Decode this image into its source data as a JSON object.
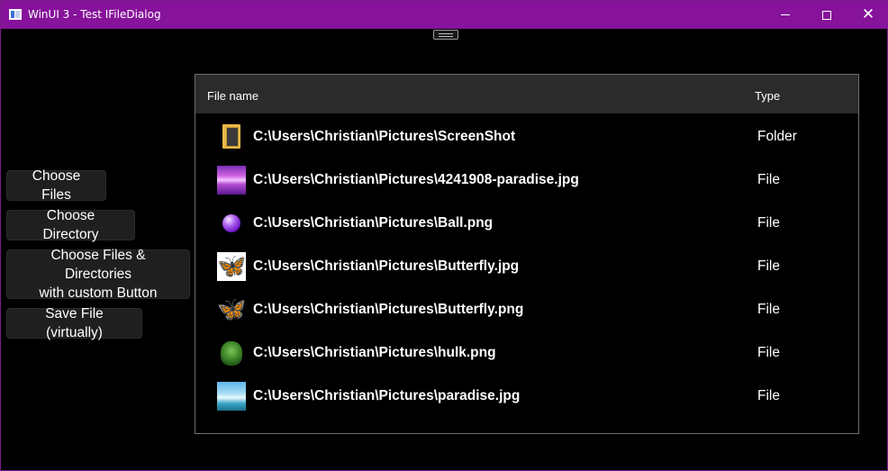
{
  "window": {
    "title": "WinUI 3 - Test IFileDialog",
    "caption": {
      "minimize": "minimize",
      "maximize": "maximize",
      "close": "✕"
    }
  },
  "buttons": {
    "choose_files": "Choose Files",
    "choose_directory": "Choose Directory",
    "choose_both_line1": "Choose Files & Directories",
    "choose_both_line2": "with custom Button",
    "save_file": "Save File (virtually)"
  },
  "list": {
    "headers": {
      "name": "File name",
      "type": "Type"
    },
    "rows": [
      {
        "path": "C:\\Users\\Christian\\Pictures\\ScreenShot",
        "type": "Folder",
        "icon": "folder-icon"
      },
      {
        "path": "C:\\Users\\Christian\\Pictures\\4241908-paradise.jpg",
        "type": "File",
        "icon": "paradise-purple-thumbnail"
      },
      {
        "path": "C:\\Users\\Christian\\Pictures\\Ball.png",
        "type": "File",
        "icon": "ball-thumbnail"
      },
      {
        "path": "C:\\Users\\Christian\\Pictures\\Butterfly.jpg",
        "type": "File",
        "icon": "butterfly-jpg-thumbnail"
      },
      {
        "path": "C:\\Users\\Christian\\Pictures\\Butterfly.png",
        "type": "File",
        "icon": "butterfly-png-thumbnail"
      },
      {
        "path": "C:\\Users\\Christian\\Pictures\\hulk.png",
        "type": "File",
        "icon": "hulk-thumbnail"
      },
      {
        "path": "C:\\Users\\Christian\\Pictures\\paradise.jpg",
        "type": "File",
        "icon": "paradise-blue-thumbnail"
      }
    ]
  },
  "colors": {
    "titlebar": "#86139a",
    "background": "#000000",
    "header": "#2b2b2b",
    "button": "#1f1f1f"
  }
}
